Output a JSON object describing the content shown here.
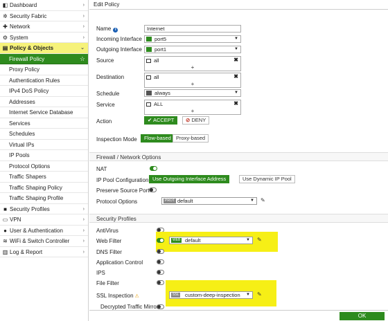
{
  "sidebar": {
    "items": [
      {
        "icon": "dashboard-icon",
        "glyph": "◧",
        "label": "Dashboard",
        "caret": "›"
      },
      {
        "icon": "security-fabric-icon",
        "glyph": "✲",
        "label": "Security Fabric",
        "caret": "›"
      },
      {
        "icon": "network-icon",
        "glyph": "✚",
        "label": "Network",
        "caret": "›"
      },
      {
        "icon": "system-icon",
        "glyph": "⚙",
        "label": "System",
        "caret": "›"
      },
      {
        "icon": "policy-objects-icon",
        "glyph": "▤",
        "label": "Policy & Objects",
        "caret": "⌄"
      }
    ],
    "policy_children": [
      "Firewall Policy",
      "Proxy Policy",
      "Authentication Rules",
      "IPv4 DoS Policy",
      "Addresses",
      "Internet Service Database",
      "Services",
      "Schedules",
      "Virtual IPs",
      "IP Pools",
      "Protocol Options",
      "Traffic Shapers",
      "Traffic Shaping Policy",
      "Traffic Shaping Profile"
    ],
    "bottom_items": [
      {
        "icon": "security-profiles-icon",
        "glyph": "🔒",
        "label": "Security Profiles",
        "caret": "›"
      },
      {
        "icon": "vpn-icon",
        "glyph": "▭",
        "label": "VPN",
        "caret": "›"
      },
      {
        "icon": "user-auth-icon",
        "glyph": "👤",
        "label": "User & Authentication",
        "caret": "›"
      },
      {
        "icon": "wifi-switch-icon",
        "glyph": "≋",
        "label": "WiFi & Switch Controller",
        "caret": "›"
      },
      {
        "icon": "log-report-icon",
        "glyph": "▥",
        "label": "Log & Report",
        "caret": "›"
      }
    ]
  },
  "panel": {
    "title": "Edit Policy"
  },
  "form": {
    "name_label": "Name",
    "name_value": "Internet",
    "incoming_label": "Incoming Interface",
    "incoming_value": "port5",
    "outgoing_label": "Outgoing Interface",
    "outgoing_value": "port1",
    "source_label": "Source",
    "source_value": "all",
    "destination_label": "Destination",
    "destination_value": "all",
    "schedule_label": "Schedule",
    "schedule_value": "always",
    "service_label": "Service",
    "service_value": "ALL",
    "action_label": "Action",
    "accept_label": "ACCEPT",
    "deny_label": "DENY",
    "inspection_label": "Inspection Mode",
    "flow_label": "Flow-based",
    "proxy_label": "Proxy-based",
    "plus": "+",
    "remove": "✖",
    "arrow": "▼"
  },
  "nat_section": {
    "header": "Firewall / Network Options",
    "nat_label": "NAT",
    "ip_pool_label": "IP Pool Configuration",
    "use_outgoing": "Use Outgoing Interface Address",
    "use_dynamic": "Use Dynamic IP Pool",
    "preserve_label": "Preserve Source Port",
    "protocol_label": "Protocol Options",
    "protocol_tag": "PROT",
    "protocol_value": "default"
  },
  "profiles": {
    "header": "Security Profiles",
    "antivirus": "AntiVirus",
    "web_filter": "Web Filter",
    "web_tag": "WEB",
    "web_value": "default",
    "dns_filter": "DNS Filter",
    "app_control": "Application Control",
    "ips": "IPS",
    "file_filter": "File Filter",
    "ssl_label": "SSL Inspection",
    "ssl_tag": "SSL",
    "ssl_value": "custom-deep-inspection",
    "decrypted": "Decrypted Traffic Mirror"
  },
  "footer": {
    "ok": "OK"
  },
  "colors": {
    "accent": "#2e8b1e",
    "highlight": "#f6ef16"
  }
}
